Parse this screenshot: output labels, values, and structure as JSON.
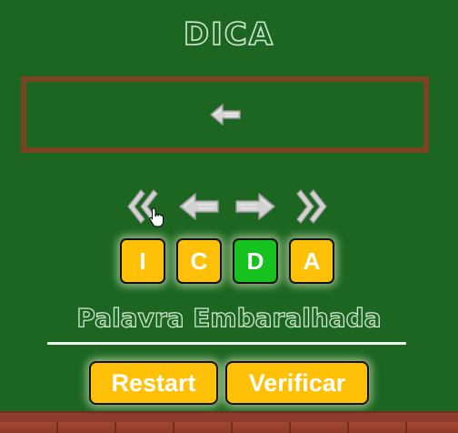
{
  "hint": {
    "title": "DICA",
    "content_icon": "left-arrow-icon"
  },
  "controls": {
    "icons": [
      "double-left-icon",
      "left-arrow-icon",
      "right-arrow-icon",
      "double-right-icon"
    ]
  },
  "word": {
    "letters": [
      {
        "char": "I",
        "color": "#ffc107"
      },
      {
        "char": "C",
        "color": "#ffc107"
      },
      {
        "char": "D",
        "color": "#16c21e"
      },
      {
        "char": "A",
        "color": "#ffc107"
      }
    ]
  },
  "section": {
    "title": "Palavra Embaralhada"
  },
  "buttons": {
    "restart_label": "Restart",
    "verify_label": "Verificar"
  },
  "colors": {
    "board": "#1c6621",
    "frame": "#7a4322",
    "tile_yellow": "#ffc107",
    "tile_green": "#16c21e",
    "chalk": "#cfcfcf"
  }
}
